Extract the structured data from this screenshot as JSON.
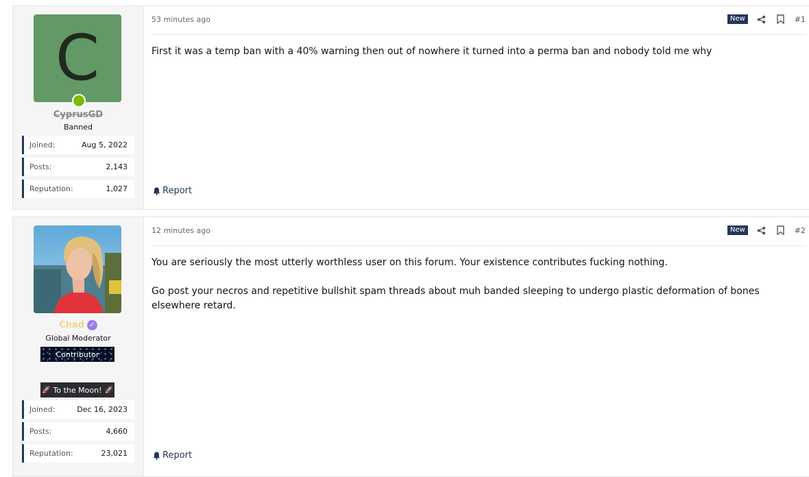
{
  "posts": [
    {
      "avatar_letter": "C",
      "username": "CyprusGD",
      "user_title": "Banned",
      "stats": [
        {
          "label": "Joined:",
          "value": "Aug 5, 2022"
        },
        {
          "label": "Posts:",
          "value": "2,143"
        },
        {
          "label": "Reputation:",
          "value": "1,027"
        }
      ],
      "time": "53 minutes ago",
      "badge": "New",
      "number": "#1",
      "paragraphs": [
        "First it was a temp ban with a 40% warning then out of nowhere it turned into a perma ban and nobody told me why"
      ],
      "report_label": "Report"
    },
    {
      "username": "Chad",
      "user_title": "Global Moderator",
      "banner1": "Contributor",
      "banner2": "To the Moon!",
      "stats": [
        {
          "label": "Joined:",
          "value": "Dec 16, 2023"
        },
        {
          "label": "Posts:",
          "value": "4,660"
        },
        {
          "label": "Reputation:",
          "value": "23,021"
        }
      ],
      "time": "12 minutes ago",
      "badge": "New",
      "number": "#2",
      "paragraphs": [
        "You are seriously the most utterly worthless user on this forum. Your existence contributes fucking nothing.",
        "Go post your necros and repetitive bullshit spam threads about muh banded sleeping to undergo plastic deformation of bones elsewhere retard."
      ],
      "report_label": "Report"
    }
  ],
  "icons": {
    "share": "share-icon",
    "bookmark": "bookmark-icon",
    "report": "bell-icon",
    "verified": "check-icon",
    "rocket": "rocket-icon"
  },
  "colors": {
    "accent": "#25365b",
    "avatar_bg": "#629966",
    "online": "#7fb800",
    "mod_name": "#f2d58a",
    "verified": "#9b7de9"
  }
}
